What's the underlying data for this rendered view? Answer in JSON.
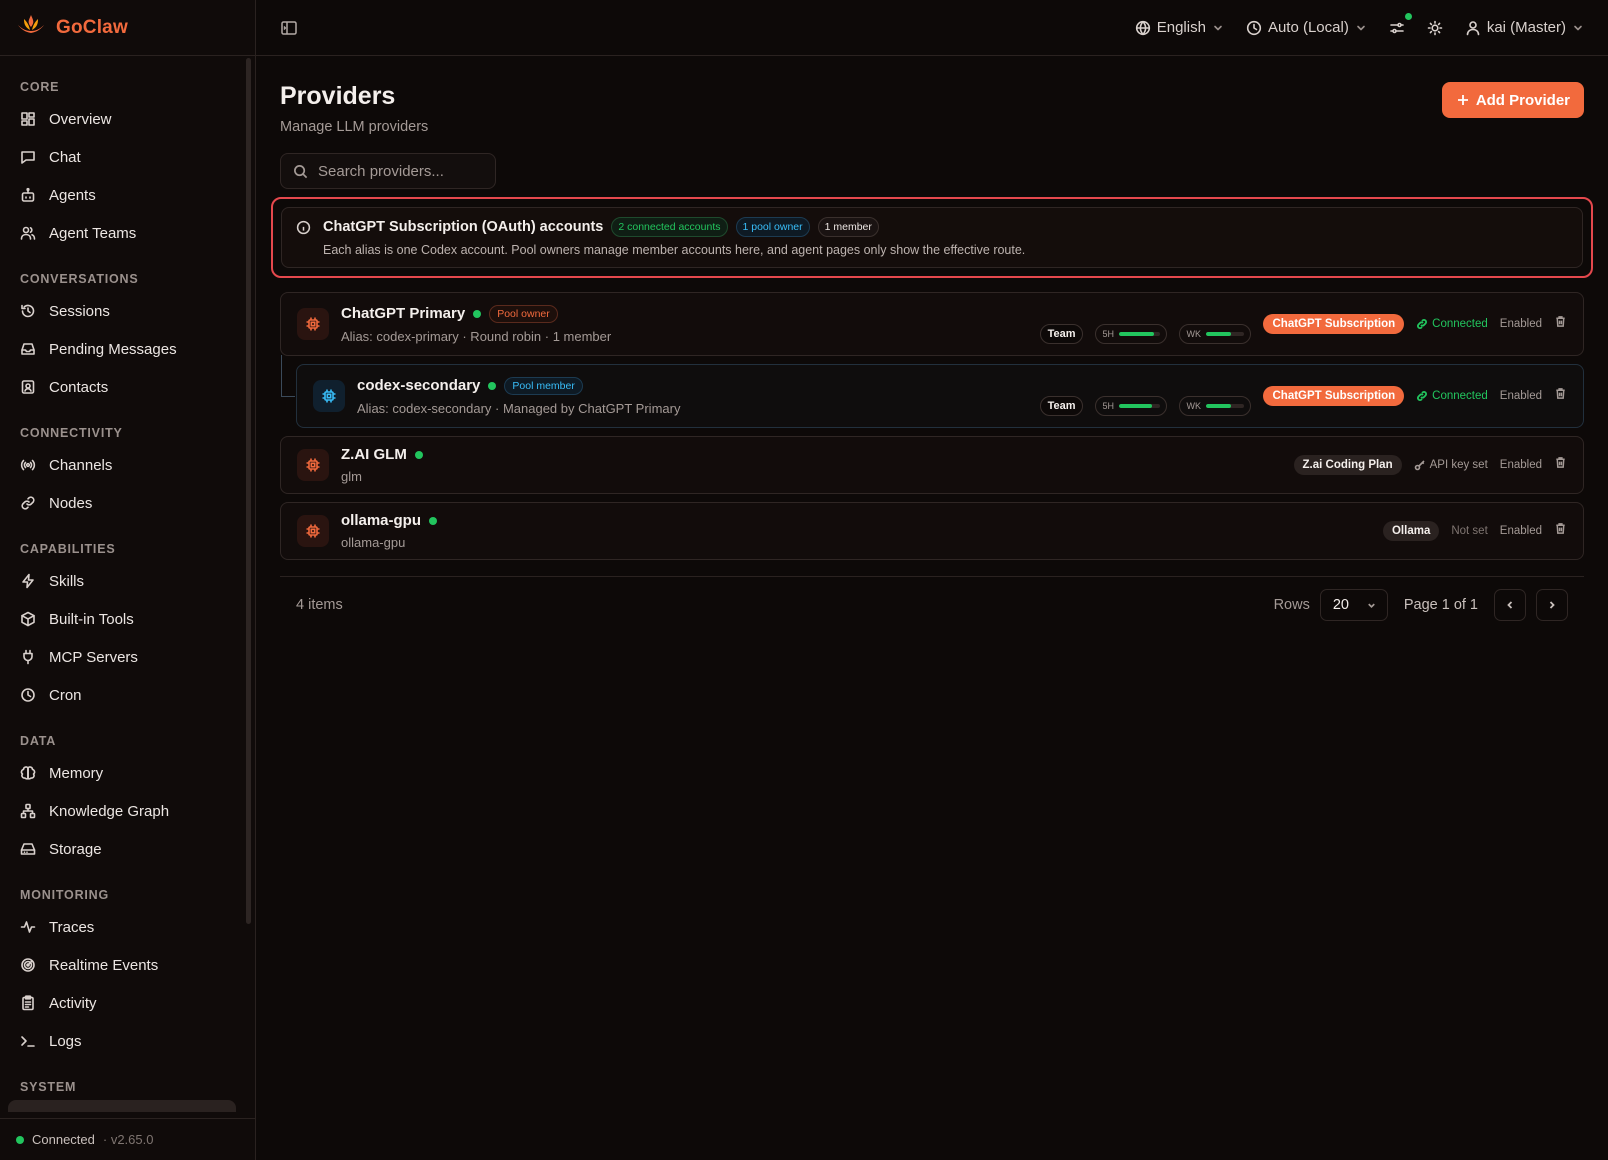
{
  "app": {
    "name": "GoClaw"
  },
  "sidebar": {
    "sections": [
      {
        "title": "CORE",
        "items": [
          {
            "label": "Overview",
            "icon": "dashboard-icon"
          },
          {
            "label": "Chat",
            "icon": "chat-bubble-icon"
          },
          {
            "label": "Agents",
            "icon": "bot-icon"
          },
          {
            "label": "Agent Teams",
            "icon": "users-icon"
          }
        ]
      },
      {
        "title": "CONVERSATIONS",
        "items": [
          {
            "label": "Sessions",
            "icon": "history-icon"
          },
          {
            "label": "Pending Messages",
            "icon": "inbox-icon"
          },
          {
            "label": "Contacts",
            "icon": "contact-icon"
          }
        ]
      },
      {
        "title": "CONNECTIVITY",
        "items": [
          {
            "label": "Channels",
            "icon": "broadcast-icon"
          },
          {
            "label": "Nodes",
            "icon": "link-icon"
          }
        ]
      },
      {
        "title": "CAPABILITIES",
        "items": [
          {
            "label": "Skills",
            "icon": "zap-icon"
          },
          {
            "label": "Built-in Tools",
            "icon": "package-icon"
          },
          {
            "label": "MCP Servers",
            "icon": "plug-icon"
          },
          {
            "label": "Cron",
            "icon": "clock-icon"
          }
        ]
      },
      {
        "title": "DATA",
        "items": [
          {
            "label": "Memory",
            "icon": "brain-icon"
          },
          {
            "label": "Knowledge Graph",
            "icon": "graph-icon"
          },
          {
            "label": "Storage",
            "icon": "hard-drive-icon"
          }
        ]
      },
      {
        "title": "MONITORING",
        "items": [
          {
            "label": "Traces",
            "icon": "activity-line-icon"
          },
          {
            "label": "Realtime Events",
            "icon": "radar-icon"
          },
          {
            "label": "Activity",
            "icon": "clipboard-icon"
          },
          {
            "label": "Logs",
            "icon": "terminal-icon"
          }
        ]
      },
      {
        "title": "SYSTEM",
        "items": []
      }
    ],
    "footer": {
      "status": "Connected",
      "version": "· v2.65.0"
    }
  },
  "topbar": {
    "language": "English",
    "timezone": "Auto (Local)",
    "user": "kai (Master)"
  },
  "page": {
    "title": "Providers",
    "subtitle": "Manage LLM providers",
    "add_button": "Add Provider",
    "search_placeholder": "Search providers..."
  },
  "info": {
    "title": "ChatGPT Subscription (OAuth) accounts",
    "badge_connected": "2 connected accounts",
    "badge_owner": "1 pool owner",
    "badge_member": "1 member",
    "description": "Each alias is one Codex account. Pool owners manage member accounts here, and agent pages only show the effective route."
  },
  "providers": [
    {
      "name": "ChatGPT Primary",
      "pool_badge": "Pool owner",
      "subtitle": "Alias: codex-primary · Round robin · 1 member",
      "team": "Team",
      "meter_5h_label": "5H",
      "meter_5h": 0.85,
      "meter_wk_label": "WK",
      "meter_wk": 0.65,
      "plan": "ChatGPT Subscription",
      "auth": "Connected",
      "state": "Enabled"
    },
    {
      "name": "codex-secondary",
      "pool_badge": "Pool member",
      "subtitle": "Alias: codex-secondary · Managed by ChatGPT Primary",
      "team": "Team",
      "meter_5h_label": "5H",
      "meter_5h": 0.8,
      "meter_wk_label": "WK",
      "meter_wk": 0.65,
      "plan": "ChatGPT Subscription",
      "auth": "Connected",
      "state": "Enabled"
    },
    {
      "name": "Z.AI GLM",
      "subtitle": "glm",
      "plan": "Z.ai Coding Plan",
      "auth": "API key set",
      "state": "Enabled"
    },
    {
      "name": "ollama-gpu",
      "subtitle": "ollama-gpu",
      "plan": "Ollama",
      "auth": "Not set",
      "state": "Enabled"
    }
  ],
  "pagination": {
    "items": "4 items",
    "rows_label": "Rows",
    "rows_value": "20",
    "page_info": "Page 1 of 1"
  },
  "colors": {
    "accent": "#f26a3d",
    "success": "#22c55e",
    "info": "#38bdf8",
    "highlight": "#e5484d"
  }
}
